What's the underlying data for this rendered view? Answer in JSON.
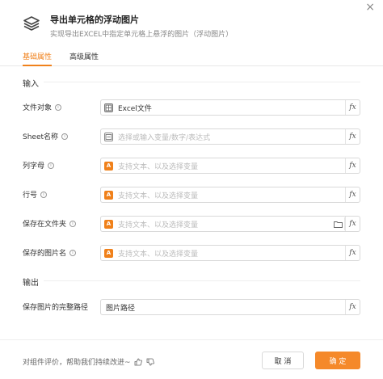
{
  "dialog": {
    "title": "导出单元格的浮动图片",
    "description": "实现导出EXCEL中指定单元格上悬浮的图片（浮动图片）",
    "close_label": "×"
  },
  "tabs": [
    {
      "label": "基础属性",
      "active": true
    },
    {
      "label": "高级属性",
      "active": false
    }
  ],
  "input_section": {
    "title": "输入",
    "fields": [
      {
        "label": "文件对象",
        "value": "Excel文件",
        "placeholder": "",
        "icon": "excel-icon"
      },
      {
        "label": "Sheet名称",
        "value": "",
        "placeholder": "选择或输入变量/数字/表达式",
        "icon": "variable-icon"
      },
      {
        "label": "列字母",
        "value": "",
        "placeholder": "支持文本、以及选择变量",
        "icon": "text-icon"
      },
      {
        "label": "行号",
        "value": "",
        "placeholder": "支持文本、以及选择变量",
        "icon": "text-icon"
      },
      {
        "label": "保存在文件夹",
        "value": "",
        "placeholder": "支持文本、以及选择变量",
        "icon": "text-icon"
      },
      {
        "label": "保存的图片名",
        "value": "",
        "placeholder": "支持文本、以及选择变量",
        "icon": "text-icon"
      }
    ]
  },
  "output_section": {
    "title": "输出",
    "fields": [
      {
        "label": "保存图片的完整路径",
        "value": "图片路径"
      }
    ]
  },
  "footer": {
    "feedback_text": "对组件评价，帮助我们持续改进~",
    "cancel_label": "取 消",
    "confirm_label": "确 定"
  },
  "colors": {
    "accent": "#f0811b",
    "confirm_button": "#f5892a"
  },
  "fx_label": "fx",
  "text_icon_glyph": "A"
}
